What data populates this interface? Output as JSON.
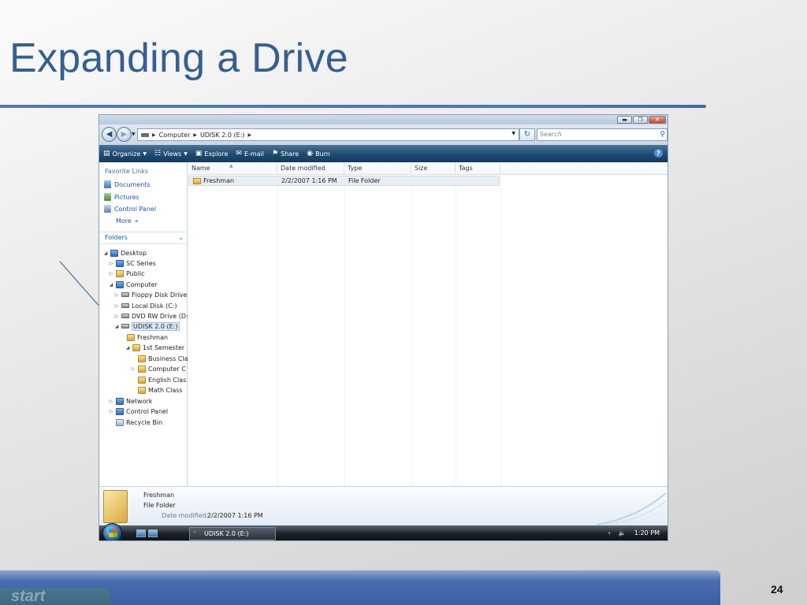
{
  "slide": {
    "title": "Expanding a Drive",
    "page_number": "24",
    "ghost_start_label": "start"
  },
  "window": {
    "address": {
      "crumbs": [
        "Computer",
        "UDISK 2.0 (E:)"
      ]
    },
    "search_placeholder": "Search",
    "toolbar": {
      "organize": "Organize",
      "views": "Views",
      "explore": "Explore",
      "email": "E-mail",
      "share": "Share",
      "burn": "Burn"
    },
    "favorites": {
      "heading": "Favorite Links",
      "items": [
        "Documents",
        "Pictures",
        "Control Panel"
      ],
      "more": "More",
      "more_glyph": "»"
    },
    "folders_heading": "Folders",
    "tree": [
      "Desktop",
      "SC Series",
      "Public",
      "Computer",
      "Floppy Disk Drive",
      "Local Disk (C:)",
      "DVD RW Drive (D:)",
      "UDISK 2.0 (E:)",
      "Freshman",
      "1st Semester",
      "Business Cla",
      "Computer C",
      "English Clas",
      "Math Class",
      "Network",
      "Control Panel",
      "Recycle Bin"
    ],
    "columns": [
      "Name",
      "Date modified",
      "Type",
      "Size",
      "Tags"
    ],
    "files": [
      {
        "name": "Freshman",
        "date": "2/2/2007 1:16 PM",
        "type": "File Folder"
      }
    ],
    "details": {
      "name": "Freshman",
      "type": "File Folder",
      "date_label": "Date modified:",
      "date_value": "2/2/2007 1:16 PM"
    },
    "taskbar": {
      "task_label": "UDISK 2.0 (E:)",
      "clock": "1:20 PM"
    }
  },
  "colors": {
    "title": "#365f91",
    "rule": "#4f7bb6",
    "command_bar": "#1f4a70",
    "link": "#1a56a6"
  }
}
